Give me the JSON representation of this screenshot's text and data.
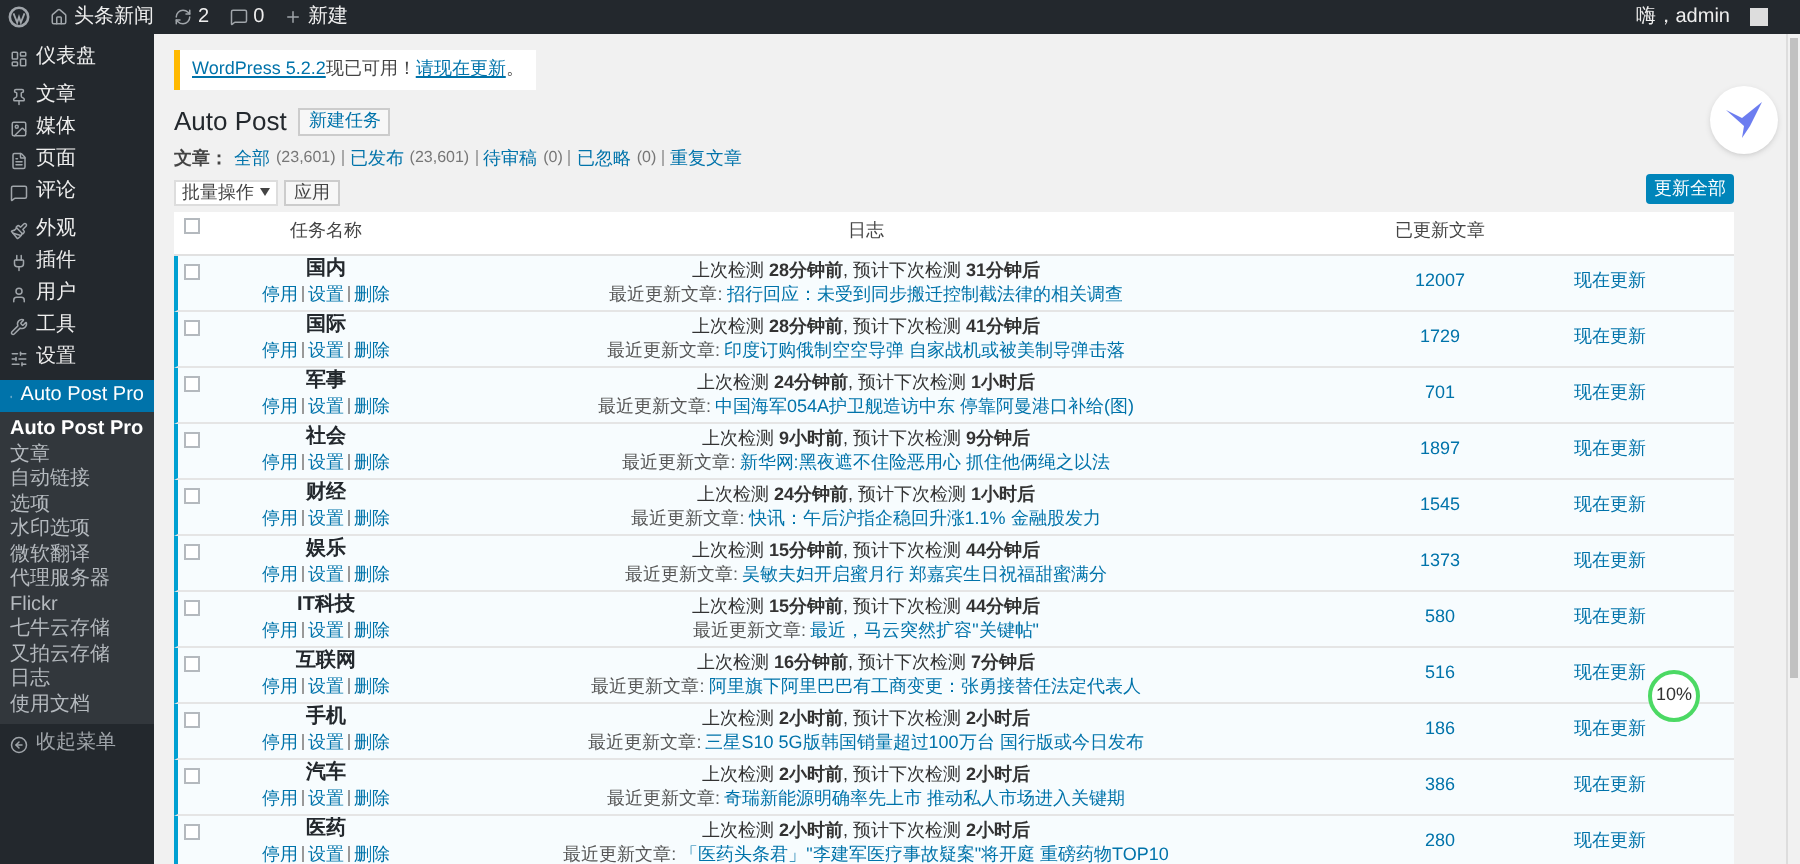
{
  "admin_bar": {
    "site": "头条新闻",
    "updates": "2",
    "comments": "0",
    "new": "新建",
    "greeting": "嗨，admin"
  },
  "sidebar": {
    "items": [
      {
        "label": "仪表盘",
        "selected": false
      },
      {
        "label": "文章",
        "selected": false
      },
      {
        "label": "媒体",
        "selected": false
      },
      {
        "label": "页面",
        "selected": false
      },
      {
        "label": "评论",
        "selected": false
      },
      {
        "label": "外观",
        "selected": false
      },
      {
        "label": "插件",
        "selected": false
      },
      {
        "label": "用户",
        "selected": false
      },
      {
        "label": "工具",
        "selected": false
      },
      {
        "label": "设置",
        "selected": false
      },
      {
        "label": "Auto Post Pro",
        "selected": true,
        "children": [
          {
            "label": "Auto Post Pro",
            "selected": true
          },
          {
            "label": "文章",
            "selected": false
          },
          {
            "label": "自动链接",
            "selected": false
          },
          {
            "label": "选项",
            "selected": false
          },
          {
            "label": "水印选项",
            "selected": false
          },
          {
            "label": "微软翻译",
            "selected": false
          },
          {
            "label": "代理服务器",
            "selected": false
          },
          {
            "label": "Flickr",
            "selected": false
          },
          {
            "label": "七牛云存储",
            "selected": false
          },
          {
            "label": "又拍云存储",
            "selected": false
          },
          {
            "label": "日志",
            "selected": false
          },
          {
            "label": "使用文档",
            "selected": false
          }
        ]
      }
    ],
    "collapse": "收起菜单"
  },
  "notice": {
    "link": "WordPress 5.2.2",
    "text": "现已可用！",
    "action": "请现在更新",
    "end": "。"
  },
  "page_title": "Auto Post",
  "add_button": "新建任务",
  "filters": {
    "label": "文章：",
    "items": [
      {
        "label": "全部",
        "count": "(23,601)"
      },
      {
        "label": "已发布",
        "count": "(23,601)"
      },
      {
        "label": "待审稿",
        "count": "(0)"
      },
      {
        "label": "已忽略",
        "count": "(0)"
      },
      {
        "label": "重复文章"
      }
    ]
  },
  "bulk": {
    "select": "批量操作",
    "apply": "应用"
  },
  "select_all_checked": false,
  "update_all": "更新全部",
  "table": {
    "columns": [
      "任务名称",
      "日志",
      "已更新文章"
    ],
    "rows": [
      {
        "name": "国内",
        "checked": false,
        "actions": [
          "停用",
          "设置",
          "删除"
        ],
        "log": "上次检测 **28分钟前**, 预计下次检测 **31分钟后**",
        "latest_label": "最近更新文章:",
        "latest": "招行回应：未受到同步搬迁控制截法律的相关调查",
        "count": "12007",
        "action": "现在更新"
      },
      {
        "name": "国际",
        "checked": false,
        "actions": [
          "停用",
          "设置",
          "删除"
        ],
        "log": "上次检测 **28分钟前**, 预计下次检测 **41分钟后**",
        "latest_label": "最近更新文章:",
        "latest": "印度订购俄制空空导弹 自家战机或被美制导弹击落",
        "count": "1729",
        "action": "现在更新"
      },
      {
        "name": "军事",
        "checked": false,
        "actions": [
          "停用",
          "设置",
          "删除"
        ],
        "log": "上次检测 **24分钟前**, 预计下次检测 **1小时后**",
        "latest_label": "最近更新文章:",
        "latest": "中国海军054A护卫舰造访中东 停靠阿曼港口补给(图)",
        "count": "701",
        "action": "现在更新"
      },
      {
        "name": "社会",
        "checked": false,
        "actions": [
          "停用",
          "设置",
          "删除"
        ],
        "log": "上次检测 **9小时前**, 预计下次检测 **9分钟后**",
        "latest_label": "最近更新文章:",
        "latest": "新华网:黑夜遮不住险恶用心 抓住他俩绳之以法",
        "count": "1897",
        "action": "现在更新"
      },
      {
        "name": "财经",
        "checked": false,
        "actions": [
          "停用",
          "设置",
          "删除"
        ],
        "log": "上次检测 **24分钟前**, 预计下次检测 **1小时后**",
        "latest_label": "最近更新文章:",
        "latest": "快讯：午后沪指企稳回升涨1.1% 金融股发力",
        "count": "1545",
        "action": "现在更新"
      },
      {
        "name": "娱乐",
        "checked": false,
        "actions": [
          "停用",
          "设置",
          "删除"
        ],
        "log": "上次检测 **15分钟前**, 预计下次检测 **44分钟后**",
        "latest_label": "最近更新文章:",
        "latest": "吴敏夫妇开启蜜月行 郑嘉宾生日祝福甜蜜满分",
        "count": "1373",
        "action": "现在更新"
      },
      {
        "name": "IT科技",
        "checked": false,
        "actions": [
          "停用",
          "设置",
          "删除"
        ],
        "log": "上次检测 **15分钟前**, 预计下次检测 **44分钟后**",
        "latest_label": "最近更新文章:",
        "latest": "最近，马云突然扩容\"关键帖\"",
        "count": "580",
        "action": "现在更新"
      },
      {
        "name": "互联网",
        "checked": false,
        "actions": [
          "停用",
          "设置",
          "删除"
        ],
        "log": "上次检测 **16分钟前**, 预计下次检测 **7分钟后**",
        "latest_label": "最近更新文章:",
        "latest": "阿里旗下阿里巴巴有工商变更：张勇接替任法定代表人",
        "count": "516",
        "action": "现在更新"
      },
      {
        "name": "手机",
        "checked": false,
        "actions": [
          "停用",
          "设置",
          "删除"
        ],
        "log": "上次检测 **2小时前**, 预计下次检测 **2小时后**",
        "latest_label": "最近更新文章:",
        "latest": "三星S10 5G版韩国销量超过100万台 国行版或今日发布",
        "count": "186",
        "action": "现在更新"
      },
      {
        "name": "汽车",
        "checked": false,
        "actions": [
          "停用",
          "设置",
          "删除"
        ],
        "log": "上次检测 **2小时前**, 预计下次检测 **2小时后**",
        "latest_label": "最近更新文章:",
        "latest": "奇瑞新能源明确率先上市 推动私人市场进入关键期",
        "count": "386",
        "action": "现在更新"
      },
      {
        "name": "医药",
        "checked": false,
        "actions": [
          "停用",
          "设置",
          "删除"
        ],
        "log": "上次检测 **2小时前**, 预计下次检测 **2小时后**",
        "latest_label": "最近更新文章:",
        "latest": "「医药头条君」\"李建军医疗事故疑案\"将开庭 重磅药物TOP10",
        "count": "280",
        "action": "现在更新"
      }
    ]
  },
  "progress_badge": "10%"
}
